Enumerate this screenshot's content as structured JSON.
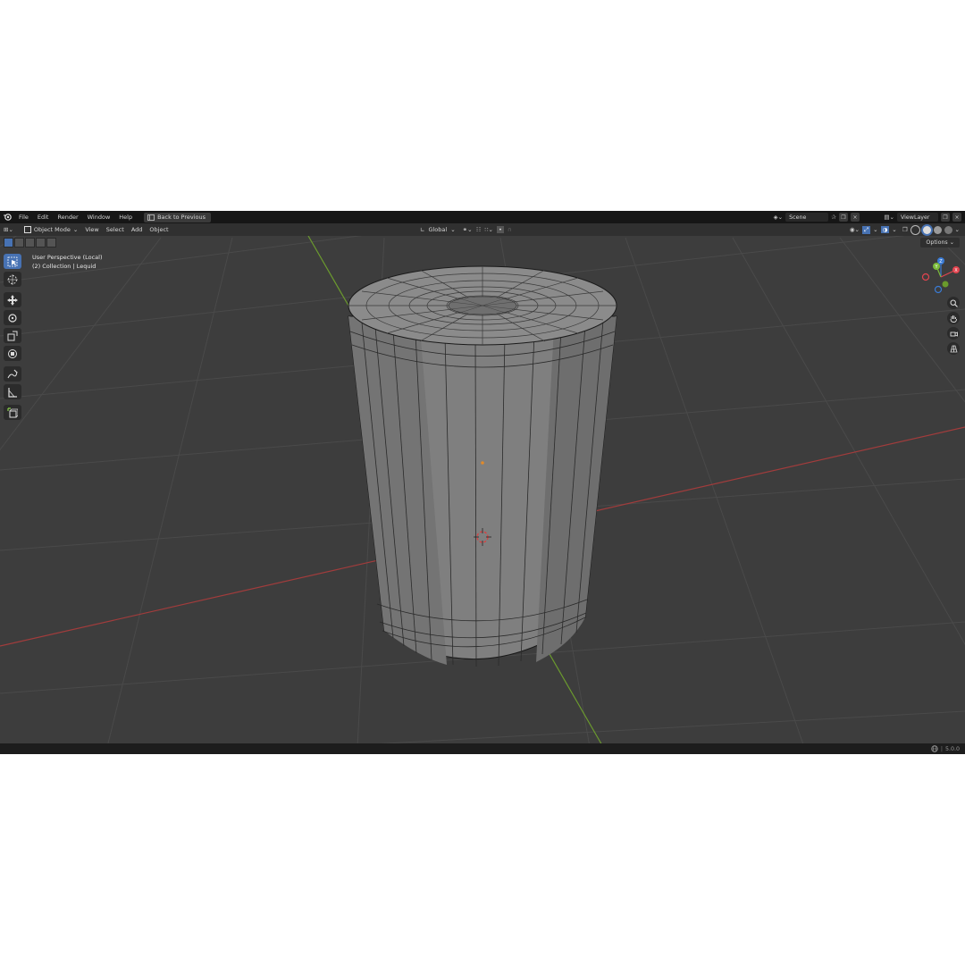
{
  "top_menu": {
    "items": [
      "File",
      "Edit",
      "Render",
      "Window",
      "Help"
    ],
    "back_button": "Back to Previous",
    "scene": "Scene",
    "view_layer": "ViewLayer"
  },
  "viewport_header": {
    "mode": "Object Mode",
    "menus": [
      "View",
      "Select",
      "Add",
      "Object"
    ],
    "transform_orientation": "Global"
  },
  "viewport": {
    "perspective_label": "User Perspective (Local)",
    "collection_label": "(2) Collection | Lequid",
    "options_label": "Options"
  },
  "gizmo": {
    "x_color": "#e2444f",
    "y_color": "#7bba3a",
    "z_color": "#3a7bd5",
    "labels": [
      "Z",
      "Y",
      "X"
    ]
  },
  "colors": {
    "grid_x_axis": "#b03a3a",
    "grid_y_axis": "#6a9b2c",
    "active_tool": "#4772b3"
  },
  "status_bar": {
    "version": "5.0.0"
  }
}
